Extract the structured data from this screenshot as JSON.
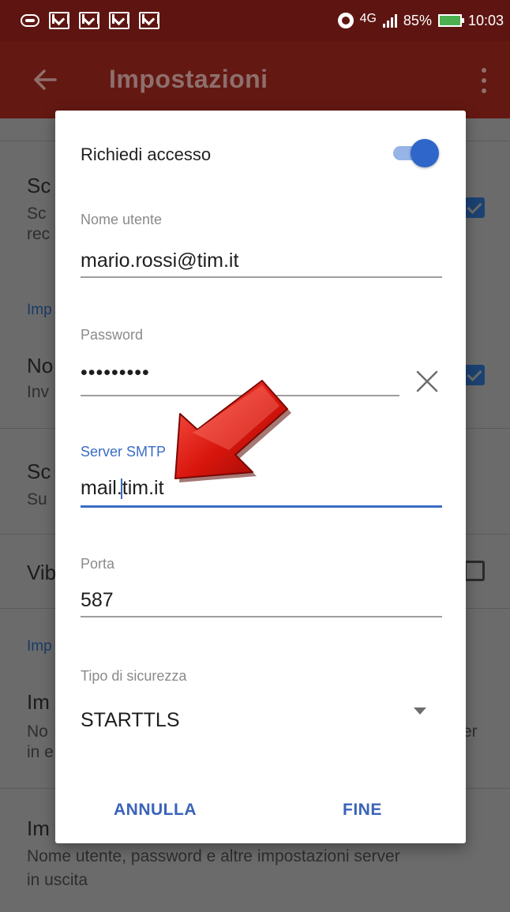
{
  "status_bar": {
    "icons": [
      "call-icon",
      "gmail-icon",
      "gmail-icon",
      "gmail-icon",
      "gmail-icon"
    ],
    "network": "4G",
    "battery": "85%",
    "time": "10:03"
  },
  "app_bar": {
    "title": "Impostazioni"
  },
  "background_list": {
    "item1": {
      "title": "Sc",
      "sub1": "Sc",
      "sub2": "rec"
    },
    "header1": "Imp",
    "item2": {
      "title": "No",
      "sub": "Inv"
    },
    "item3": {
      "title": "Sc",
      "sub": "Su"
    },
    "item4": {
      "title": "Vib"
    },
    "header2": "Imp",
    "item5": {
      "title": "Im",
      "sub1": "No",
      "sub1_end": "er",
      "sub2": "in e"
    },
    "item6": {
      "title": "Im",
      "sub1": "Nome utente, password e altre impostazioni server",
      "sub2": "in uscita"
    }
  },
  "dialog": {
    "toggle_label": "Richiedi accesso",
    "toggle_on": true,
    "username": {
      "label": "Nome utente",
      "value": "mario.rossi@tim.it"
    },
    "password": {
      "label": "Password",
      "value": "•••••••••"
    },
    "smtp": {
      "label": "Server SMTP",
      "value": "mail.tim.it"
    },
    "port": {
      "label": "Porta",
      "value": "587"
    },
    "security": {
      "label": "Tipo di sicurezza",
      "value": "STARTTLS"
    },
    "cancel_label": "ANNULLA",
    "done_label": "FINE"
  },
  "colors": {
    "app_bar": "#641812",
    "accent": "#3a6cc4",
    "arrow": "#d0140c"
  }
}
